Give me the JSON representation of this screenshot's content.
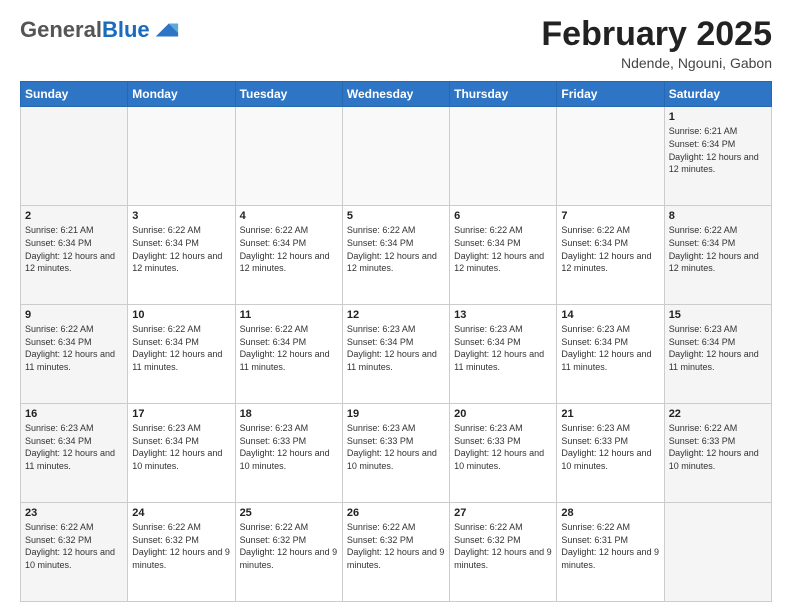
{
  "header": {
    "logo_line1": "General",
    "logo_line2": "Blue",
    "month_title": "February 2025",
    "location": "Ndende, Ngouni, Gabon"
  },
  "days_of_week": [
    "Sunday",
    "Monday",
    "Tuesday",
    "Wednesday",
    "Thursday",
    "Friday",
    "Saturday"
  ],
  "weeks": [
    [
      {
        "day": "",
        "info": ""
      },
      {
        "day": "",
        "info": ""
      },
      {
        "day": "",
        "info": ""
      },
      {
        "day": "",
        "info": ""
      },
      {
        "day": "",
        "info": ""
      },
      {
        "day": "",
        "info": ""
      },
      {
        "day": "1",
        "info": "Sunrise: 6:21 AM\nSunset: 6:34 PM\nDaylight: 12 hours and 12 minutes."
      }
    ],
    [
      {
        "day": "2",
        "info": "Sunrise: 6:21 AM\nSunset: 6:34 PM\nDaylight: 12 hours and 12 minutes."
      },
      {
        "day": "3",
        "info": "Sunrise: 6:22 AM\nSunset: 6:34 PM\nDaylight: 12 hours and 12 minutes."
      },
      {
        "day": "4",
        "info": "Sunrise: 6:22 AM\nSunset: 6:34 PM\nDaylight: 12 hours and 12 minutes."
      },
      {
        "day": "5",
        "info": "Sunrise: 6:22 AM\nSunset: 6:34 PM\nDaylight: 12 hours and 12 minutes."
      },
      {
        "day": "6",
        "info": "Sunrise: 6:22 AM\nSunset: 6:34 PM\nDaylight: 12 hours and 12 minutes."
      },
      {
        "day": "7",
        "info": "Sunrise: 6:22 AM\nSunset: 6:34 PM\nDaylight: 12 hours and 12 minutes."
      },
      {
        "day": "8",
        "info": "Sunrise: 6:22 AM\nSunset: 6:34 PM\nDaylight: 12 hours and 12 minutes."
      }
    ],
    [
      {
        "day": "9",
        "info": "Sunrise: 6:22 AM\nSunset: 6:34 PM\nDaylight: 12 hours and 11 minutes."
      },
      {
        "day": "10",
        "info": "Sunrise: 6:22 AM\nSunset: 6:34 PM\nDaylight: 12 hours and 11 minutes."
      },
      {
        "day": "11",
        "info": "Sunrise: 6:22 AM\nSunset: 6:34 PM\nDaylight: 12 hours and 11 minutes."
      },
      {
        "day": "12",
        "info": "Sunrise: 6:23 AM\nSunset: 6:34 PM\nDaylight: 12 hours and 11 minutes."
      },
      {
        "day": "13",
        "info": "Sunrise: 6:23 AM\nSunset: 6:34 PM\nDaylight: 12 hours and 11 minutes."
      },
      {
        "day": "14",
        "info": "Sunrise: 6:23 AM\nSunset: 6:34 PM\nDaylight: 12 hours and 11 minutes."
      },
      {
        "day": "15",
        "info": "Sunrise: 6:23 AM\nSunset: 6:34 PM\nDaylight: 12 hours and 11 minutes."
      }
    ],
    [
      {
        "day": "16",
        "info": "Sunrise: 6:23 AM\nSunset: 6:34 PM\nDaylight: 12 hours and 11 minutes."
      },
      {
        "day": "17",
        "info": "Sunrise: 6:23 AM\nSunset: 6:34 PM\nDaylight: 12 hours and 10 minutes."
      },
      {
        "day": "18",
        "info": "Sunrise: 6:23 AM\nSunset: 6:33 PM\nDaylight: 12 hours and 10 minutes."
      },
      {
        "day": "19",
        "info": "Sunrise: 6:23 AM\nSunset: 6:33 PM\nDaylight: 12 hours and 10 minutes."
      },
      {
        "day": "20",
        "info": "Sunrise: 6:23 AM\nSunset: 6:33 PM\nDaylight: 12 hours and 10 minutes."
      },
      {
        "day": "21",
        "info": "Sunrise: 6:23 AM\nSunset: 6:33 PM\nDaylight: 12 hours and 10 minutes."
      },
      {
        "day": "22",
        "info": "Sunrise: 6:22 AM\nSunset: 6:33 PM\nDaylight: 12 hours and 10 minutes."
      }
    ],
    [
      {
        "day": "23",
        "info": "Sunrise: 6:22 AM\nSunset: 6:32 PM\nDaylight: 12 hours and 10 minutes."
      },
      {
        "day": "24",
        "info": "Sunrise: 6:22 AM\nSunset: 6:32 PM\nDaylight: 12 hours and 9 minutes."
      },
      {
        "day": "25",
        "info": "Sunrise: 6:22 AM\nSunset: 6:32 PM\nDaylight: 12 hours and 9 minutes."
      },
      {
        "day": "26",
        "info": "Sunrise: 6:22 AM\nSunset: 6:32 PM\nDaylight: 12 hours and 9 minutes."
      },
      {
        "day": "27",
        "info": "Sunrise: 6:22 AM\nSunset: 6:32 PM\nDaylight: 12 hours and 9 minutes."
      },
      {
        "day": "28",
        "info": "Sunrise: 6:22 AM\nSunset: 6:31 PM\nDaylight: 12 hours and 9 minutes."
      },
      {
        "day": "",
        "info": ""
      }
    ]
  ]
}
